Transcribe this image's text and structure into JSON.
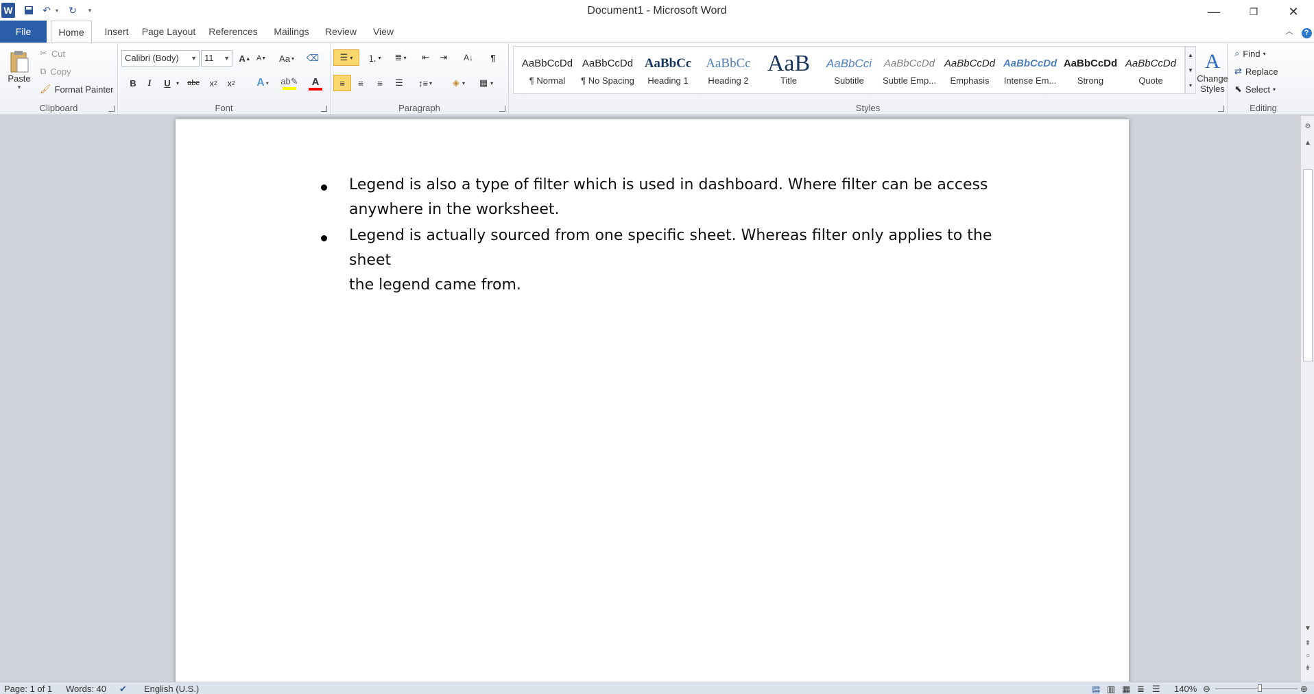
{
  "window": {
    "title": "Document1 - Microsoft Word"
  },
  "tabs": [
    "File",
    "Home",
    "Insert",
    "Page Layout",
    "References",
    "Mailings",
    "Review",
    "View"
  ],
  "clipboard": {
    "paste": "Paste",
    "cut": "Cut",
    "copy": "Copy",
    "format_painter": "Format Painter",
    "label": "Clipboard"
  },
  "font": {
    "family": "Calibri (Body)",
    "size": "11",
    "label": "Font",
    "grow": "A",
    "shrink": "A",
    "change_case": "Aa",
    "bold": "B",
    "italic": "I",
    "underline": "U",
    "strike": "abc",
    "subscript": "x",
    "superscript": "x",
    "text_effect": "A",
    "font_color": "A"
  },
  "paragraph": {
    "label": "Paragraph",
    "show_marks": "¶"
  },
  "styles": {
    "label": "Styles",
    "items": [
      {
        "preview": "AaBbCcDd",
        "name": "¶ Normal"
      },
      {
        "preview": "AaBbCcDd",
        "name": "¶ No Spacing"
      },
      {
        "preview": "AaBbCc",
        "name": "Heading 1"
      },
      {
        "preview": "AaBbCc",
        "name": "Heading 2"
      },
      {
        "preview": "AaB",
        "name": "Title"
      },
      {
        "preview": "AaBbCci",
        "name": "Subtitle"
      },
      {
        "preview": "AaBbCcDd",
        "name": "Subtle Emp..."
      },
      {
        "preview": "AaBbCcDd",
        "name": "Emphasis"
      },
      {
        "preview": "AaBbCcDd",
        "name": "Intense Em..."
      },
      {
        "preview": "AaBbCcDd",
        "name": "Strong"
      },
      {
        "preview": "AaBbCcDd",
        "name": "Quote"
      }
    ],
    "change_styles_1": "Change",
    "change_styles_2": "Styles"
  },
  "editing": {
    "find": "Find",
    "replace": "Replace",
    "select": "Select",
    "label": "Editing"
  },
  "document": {
    "bullets": [
      {
        "line1": "Legend is also a type of filter which is used in dashboard. Where filter can be access",
        "line2": "anywhere in the worksheet."
      },
      {
        "line1": "Legend is actually sourced from one specific sheet. Whereas filter only applies to the sheet",
        "line2": "the legend came from."
      }
    ]
  },
  "status": {
    "page": "Page: 1 of 1",
    "words": "Words: 40",
    "language": "English (U.S.)",
    "zoom": "140%"
  },
  "colors": {
    "file_tab": "#2a5ea8",
    "accent": "#2b579a",
    "highlight": "#ffff00",
    "font_color": "#ff0000"
  }
}
